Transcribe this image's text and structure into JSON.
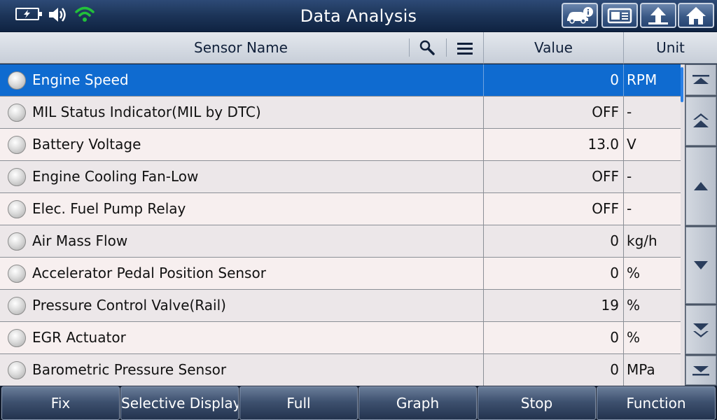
{
  "app": {
    "title": "Data Analysis"
  },
  "status_bar": {
    "icons": [
      "battery-charging-icon",
      "speaker-icon",
      "wifi-icon"
    ],
    "wifi_color": "#22c13a"
  },
  "top_buttons": [
    "vehicle-info-icon",
    "report-icon",
    "back-up-arrow-icon",
    "home-icon"
  ],
  "table": {
    "headers": {
      "name": "Sensor Name",
      "value": "Value",
      "unit": "Unit"
    },
    "header_icons": [
      "search-icon",
      "menu-icon"
    ],
    "selected_row": 0,
    "selected_color": "#0f6bd0",
    "rows": [
      {
        "name": "Engine Speed",
        "value": "0",
        "unit": "RPM"
      },
      {
        "name": "MIL Status Indicator(MIL by DTC)",
        "value": "OFF",
        "unit": "-"
      },
      {
        "name": "Battery Voltage",
        "value": "13.0",
        "unit": "V"
      },
      {
        "name": "Engine Cooling Fan-Low",
        "value": "OFF",
        "unit": "-"
      },
      {
        "name": "Elec. Fuel Pump Relay",
        "value": "OFF",
        "unit": "-"
      },
      {
        "name": "Air Mass Flow",
        "value": "0",
        "unit": "kg/h"
      },
      {
        "name": "Accelerator Pedal Position Sensor",
        "value": "0",
        "unit": "%"
      },
      {
        "name": "Pressure Control Valve(Rail)",
        "value": "19",
        "unit": "%"
      },
      {
        "name": "EGR Actuator",
        "value": "0",
        "unit": "%"
      },
      {
        "name": "Barometric Pressure Sensor",
        "value": "0",
        "unit": "MPa"
      }
    ]
  },
  "scroll_buttons": [
    "scroll-top-icon",
    "page-up-icon",
    "line-up-icon",
    "line-down-icon",
    "page-down-icon",
    "scroll-bottom-icon"
  ],
  "toolbar": {
    "fix": "Fix",
    "selective_display": "Selective Display",
    "full": "Full",
    "graph": "Graph",
    "stop": "Stop",
    "function": "Function"
  }
}
